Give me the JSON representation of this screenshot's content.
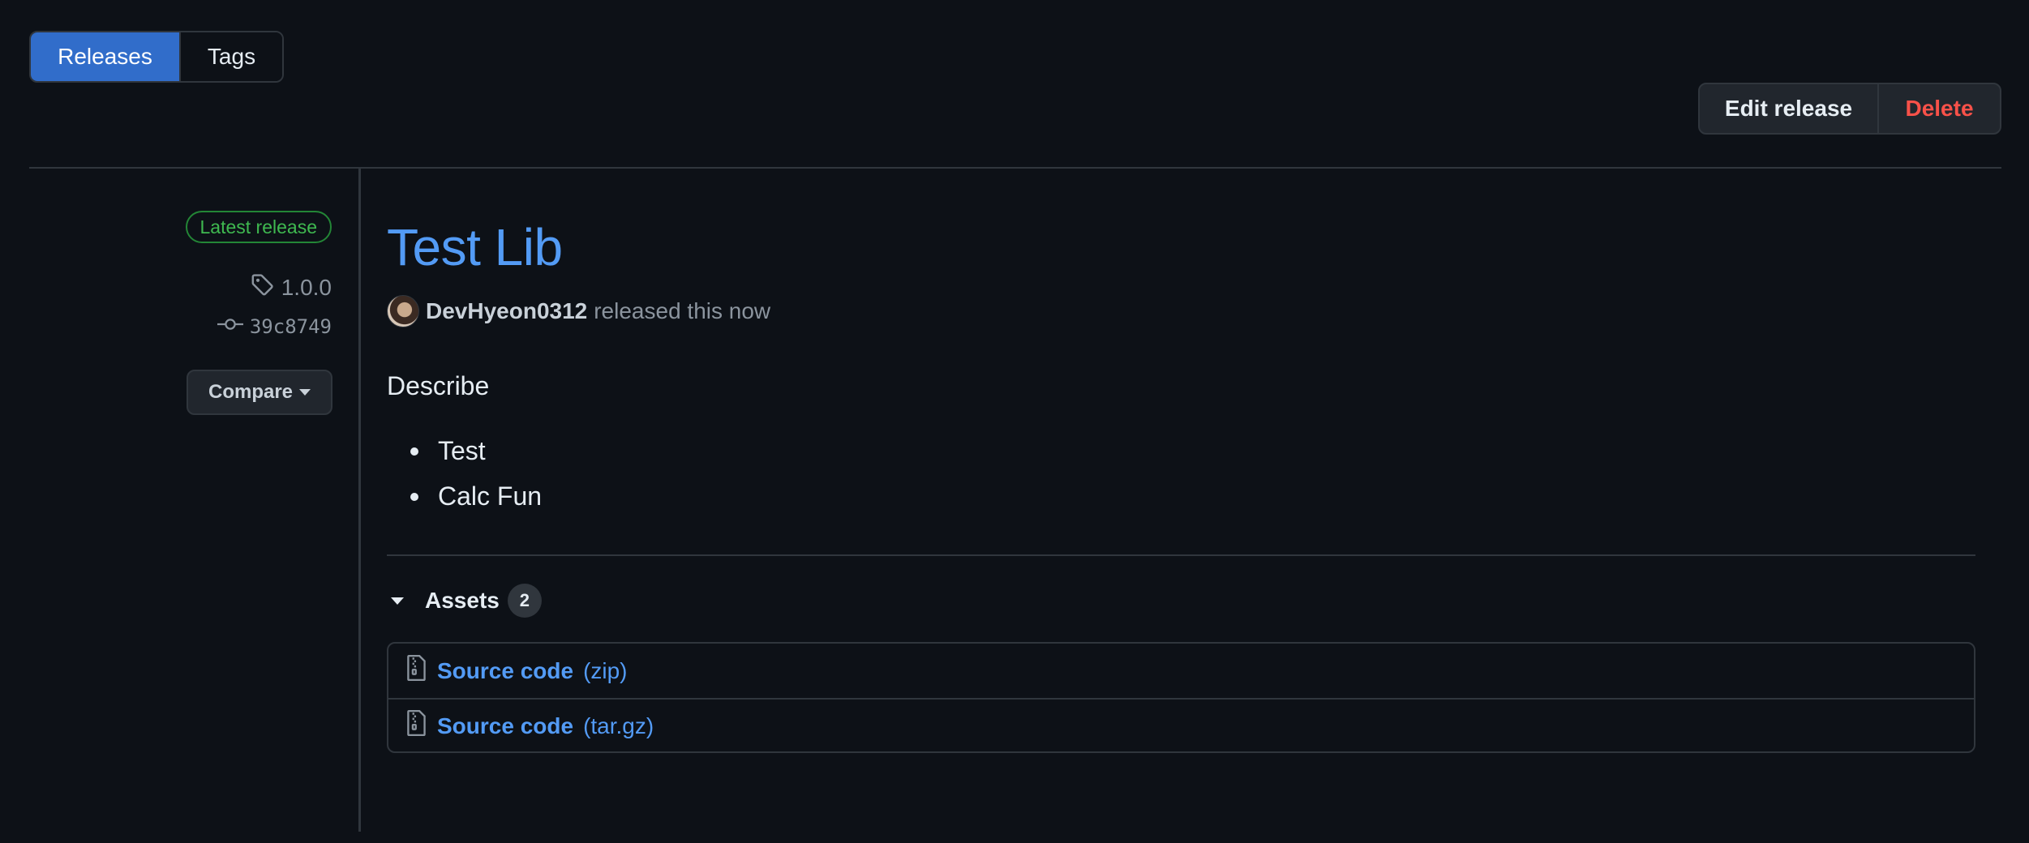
{
  "tabs": {
    "releases": "Releases",
    "tags": "Tags"
  },
  "actions": {
    "edit": "Edit release",
    "delete": "Delete"
  },
  "meta": {
    "latest": "Latest release",
    "tag": "1.0.0",
    "commit": "39c8749",
    "compare": "Compare"
  },
  "release": {
    "title": "Test Lib",
    "author": "DevHyeon0312",
    "released": "released this now",
    "describe": "Describe",
    "notes": [
      "Test",
      "Calc Fun"
    ]
  },
  "assets": {
    "label": "Assets",
    "count": "2",
    "items": [
      {
        "name": "Source code",
        "ext": "(zip)"
      },
      {
        "name": "Source code",
        "ext": "(tar.gz)"
      }
    ]
  },
  "colors": {
    "accent": "#539bf5",
    "primary_button": "#316dca",
    "danger": "#f85149",
    "success": "#3fb950",
    "background": "#0d1117"
  },
  "icons": {
    "tag": "tag-icon",
    "commit": "git-commit-icon",
    "archive": "file-zip-icon",
    "triangle": "triangle-down-icon"
  }
}
